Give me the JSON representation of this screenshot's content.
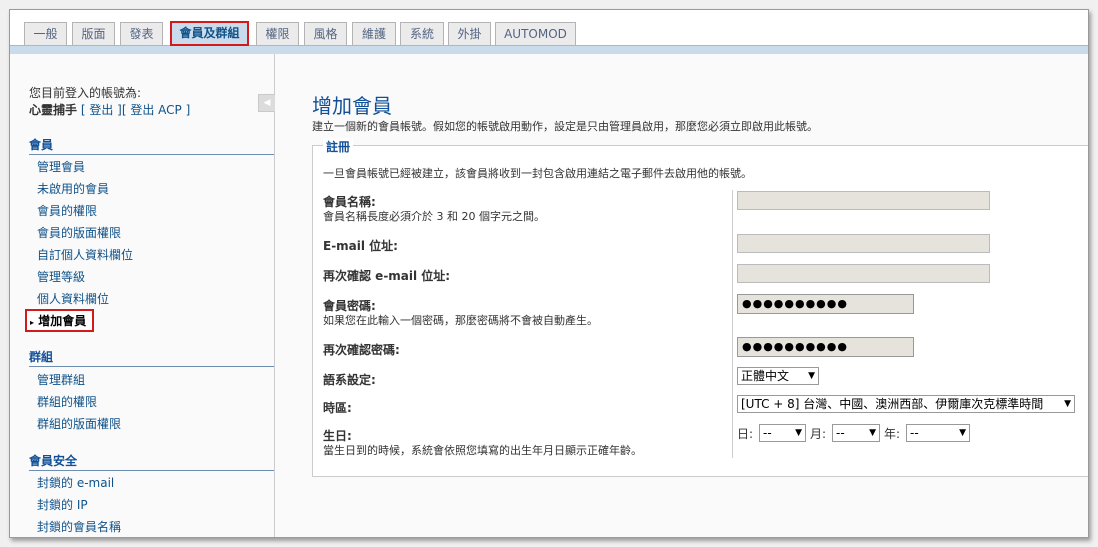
{
  "tabs": [
    {
      "label": "一般"
    },
    {
      "label": "版面"
    },
    {
      "label": "發表"
    },
    {
      "label": "會員及群組"
    },
    {
      "label": "權限"
    },
    {
      "label": "風格"
    },
    {
      "label": "維護"
    },
    {
      "label": "系統"
    },
    {
      "label": "外掛"
    },
    {
      "label": "AUTOMOD"
    }
  ],
  "active_tab": "會員及群組",
  "sidebar": {
    "login_label": "您目前登入的帳號為:",
    "username": "心靈捕手",
    "logout_text": "[ 登出 ][ 登出 ACP ]",
    "collapse_icon": "triangle-left-icon",
    "sections": [
      {
        "title": "會員",
        "items": [
          {
            "label": "管理會員"
          },
          {
            "label": "未啟用的會員"
          },
          {
            "label": "會員的權限"
          },
          {
            "label": "會員的版面權限"
          },
          {
            "label": "自訂個人資料欄位"
          },
          {
            "label": "管理等級"
          },
          {
            "label": "個人資料欄位"
          },
          {
            "label": "增加會員",
            "active": true
          }
        ]
      },
      {
        "title": "群組",
        "items": [
          {
            "label": "管理群組"
          },
          {
            "label": "群組的權限"
          },
          {
            "label": "群組的版面權限"
          }
        ]
      },
      {
        "title": "會員安全",
        "items": [
          {
            "label": "封鎖的 e-mail"
          },
          {
            "label": "封鎖的 IP"
          },
          {
            "label": "封鎖的會員名稱"
          }
        ]
      }
    ]
  },
  "main": {
    "title": "增加會員",
    "description": "建立一個新的會員帳號。假如您的帳號啟用動作，設定是只由管理員啟用，那麼您必須立即啟用此帳號。",
    "fieldset": {
      "legend": "註冊",
      "intro": "一旦會員帳號已經被建立，該會員將收到一封包含啟用連結之電子郵件去啟用他的帳號。",
      "username": {
        "label": "會員名稱:",
        "hint": "會員名稱長度必須介於 3 和 20 個字元之間。",
        "value": ""
      },
      "email": {
        "label": "E-mail 位址:",
        "value": ""
      },
      "email_confirm": {
        "label": "再次確認 e-mail 位址:",
        "value": ""
      },
      "password": {
        "label": "會員密碼:",
        "hint": "如果您在此輸入一個密碼，那麼密碼將不會被自動產生。",
        "value": "●●●●●●●●●●"
      },
      "password_confirm": {
        "label": "再次確認密碼:",
        "value": "●●●●●●●●●●"
      },
      "language": {
        "label": "語系設定:",
        "selected": "正體中文"
      },
      "timezone": {
        "label": "時區:",
        "selected": "[UTC + 8] 台灣、中國、澳洲西部、伊爾庫次克標準時間"
      },
      "birthday": {
        "label": "生日:",
        "hint": "當生日到的時候，系統會依照您填寫的出生年月日顯示正確年齡。",
        "day_label": "日:",
        "month_label": "月:",
        "year_label": "年:",
        "day_value": "--",
        "month_value": "--",
        "year_value": "--"
      }
    }
  },
  "colors": {
    "accent": "#115098",
    "highlight_border": "#d31a1a",
    "active_tab_bg": "#cadceb"
  }
}
